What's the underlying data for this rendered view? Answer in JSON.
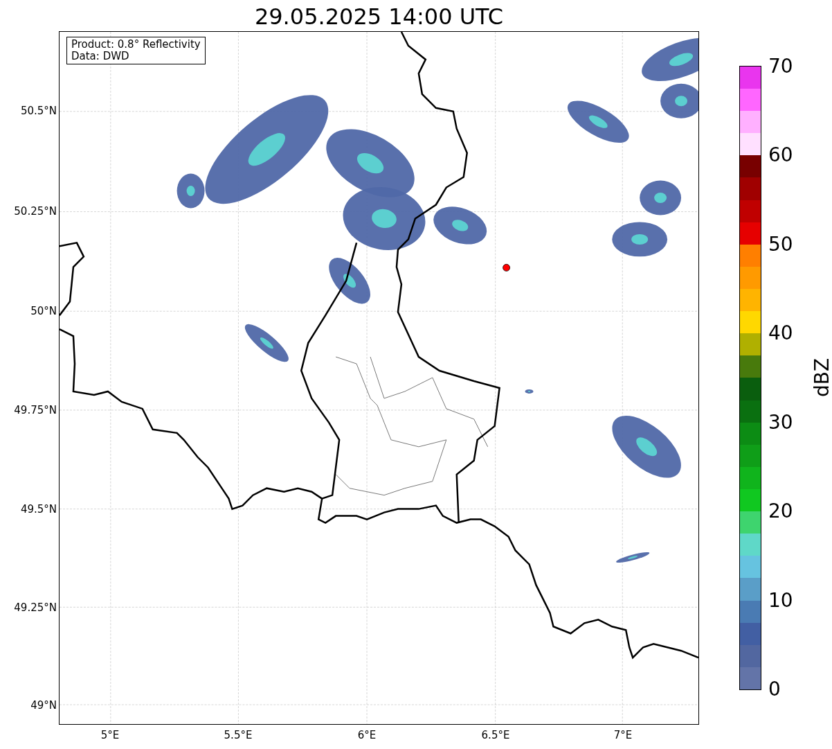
{
  "title": "29.05.2025 14:00 UTC",
  "info_box": [
    "Product: 0.8° Reflectivity",
    "Data: DWD"
  ],
  "x_ticks": [
    "5°E",
    "5.5°E",
    "6°E",
    "6.5°E",
    "7°E"
  ],
  "y_ticks": [
    "50.5°N",
    "50.25°N",
    "50°N",
    "49.75°N",
    "49.5°N",
    "49.25°N",
    "49°N"
  ],
  "colorbar": {
    "label": "dBZ",
    "ticks": [
      "70",
      "60",
      "50",
      "40",
      "30",
      "20",
      "10",
      "0"
    ],
    "levels": [
      {
        "color": "#6374a8"
      },
      {
        "color": "#5267a0"
      },
      {
        "color": "#425fa3"
      },
      {
        "color": "#4a7bb3"
      },
      {
        "color": "#5a9ec8"
      },
      {
        "color": "#66c3e0"
      },
      {
        "color": "#5fd8c8"
      },
      {
        "color": "#3ed46e"
      },
      {
        "color": "#10c820"
      },
      {
        "color": "#10b41c"
      },
      {
        "color": "#0f9e18"
      },
      {
        "color": "#0c8c14"
      },
      {
        "color": "#0a7010"
      },
      {
        "color": "#0a5e0e"
      },
      {
        "color": "#487a0c"
      },
      {
        "color": "#b0b000"
      },
      {
        "color": "#ffd800"
      },
      {
        "color": "#ffb400"
      },
      {
        "color": "#ff9a00"
      },
      {
        "color": "#ff7f00"
      },
      {
        "color": "#e60000"
      },
      {
        "color": "#c00000"
      },
      {
        "color": "#a00000"
      },
      {
        "color": "#780000"
      },
      {
        "color": "#ffe0ff"
      },
      {
        "color": "#ffb0ff"
      },
      {
        "color": "#ff66ff"
      },
      {
        "color": "#e935ee"
      }
    ]
  }
}
